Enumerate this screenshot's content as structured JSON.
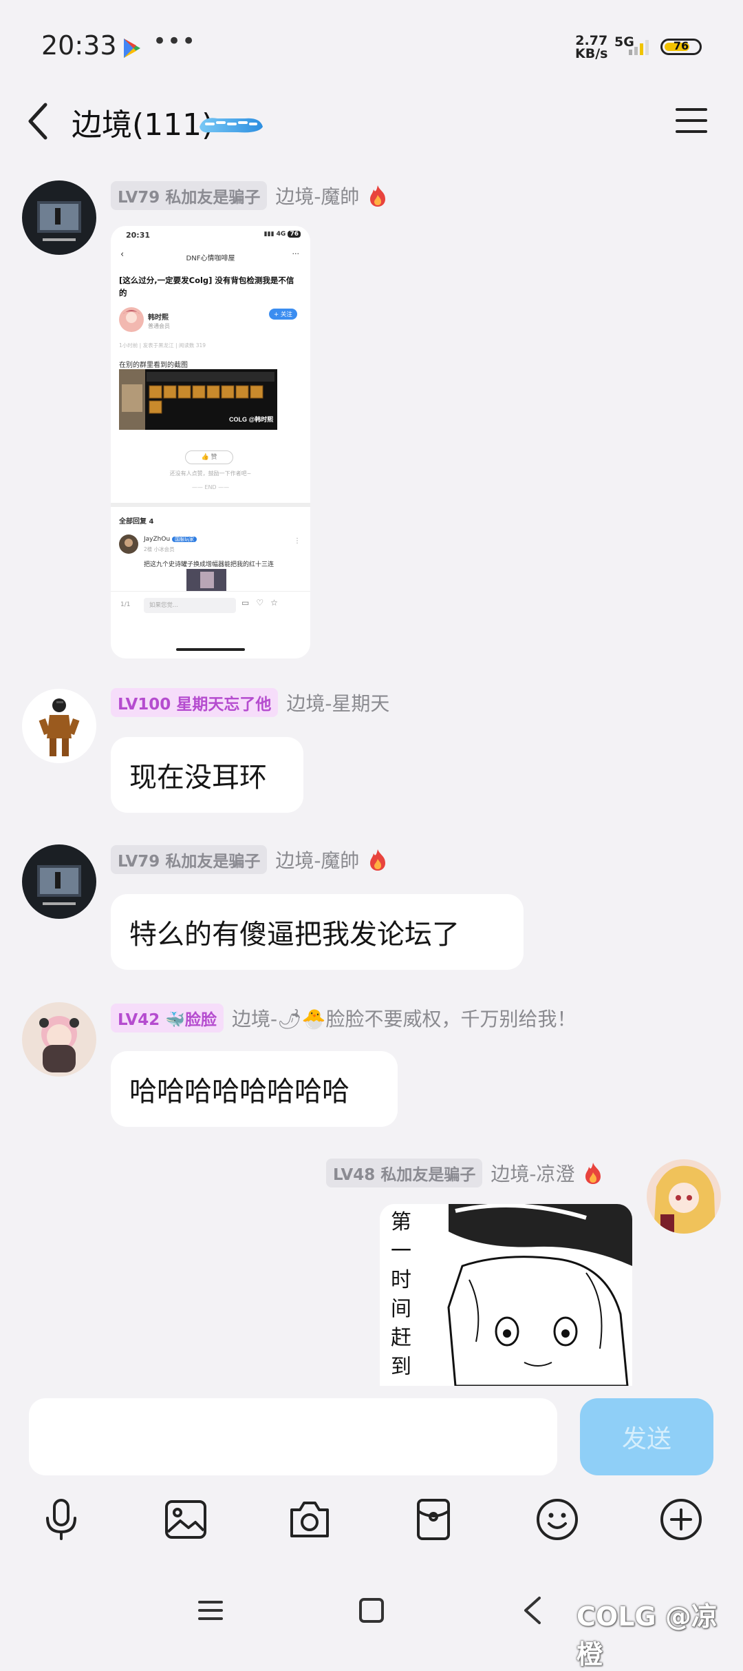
{
  "status_bar": {
    "time": "20:33",
    "net_speed_value": "2.77",
    "net_speed_unit": "KB/s",
    "network": "5G",
    "battery": "76",
    "battery_level": 0.76
  },
  "header": {
    "title": "边境(111)"
  },
  "messages": [
    {
      "level": "LV79",
      "tag": "私加友是骗子",
      "nickname": "边境-魔帥",
      "type": "image"
    },
    {
      "level": "LV100",
      "tag": "星期天忘了他",
      "nickname": "边境-星期天",
      "text": "现在没耳环"
    },
    {
      "level": "LV79",
      "tag": "私加友是骗子",
      "nickname": "边境-魔帥",
      "text": "特么的有傻逼把我发论坛了"
    },
    {
      "level": "LV42",
      "tag": "🐳脸脸",
      "nickname_prefix": "边境-",
      "nickname_emoji": "🌶🐣",
      "nickname_suffix": "脸脸不要威权，千万别给我！",
      "text": "哈哈哈哈哈哈哈哈"
    },
    {
      "level": "LV48",
      "tag": "私加友是骗子",
      "nickname": "边境-凉澄",
      "type": "image",
      "manga_text": "第一时间赶到现场嘞"
    }
  ],
  "screenshot_card": {
    "time": "20:31",
    "network": "4G",
    "battery": "76",
    "page_title": "DNF心情咖啡屋",
    "post_title": "[这么过分,一定要发Colg] 没有背包检测我是不信的",
    "author": "韩时熙",
    "author_sub": "普通会员",
    "follow_label": "+ 关注",
    "meta_line": "1小时前 | 发表于黑龙江 | 阅读数 319",
    "body_text": "在别的群里看到的截图",
    "watermark": "COLG @韩时熙",
    "like_label": "赞",
    "like_hint": "还没有人点赞，鼓励一下作者吧~",
    "end_label": "END",
    "replies_label": "全部回复 4",
    "reply_user": "JayZhOu",
    "reply_badge": "国服玩家",
    "reply_meta": "2楼 小冰会员",
    "reply_text": "把这九个史诗罐子换成增幅器能把我的红十三连",
    "page_indicator": "1/1",
    "comment_placeholder": "如果您觉..."
  },
  "input": {
    "placeholder": "",
    "send_label": "发送"
  },
  "toolbar": {
    "icons": [
      "microphone-icon",
      "image-icon",
      "camera-icon",
      "red-packet-icon",
      "emoji-icon",
      "plus-icon"
    ]
  },
  "watermark": "COLG @凉橙",
  "colors": {
    "background": "#f3f2f5",
    "send_button": "#8fcff7",
    "level_pink": "#b54ccf",
    "level_gray": "#8b8b92"
  }
}
